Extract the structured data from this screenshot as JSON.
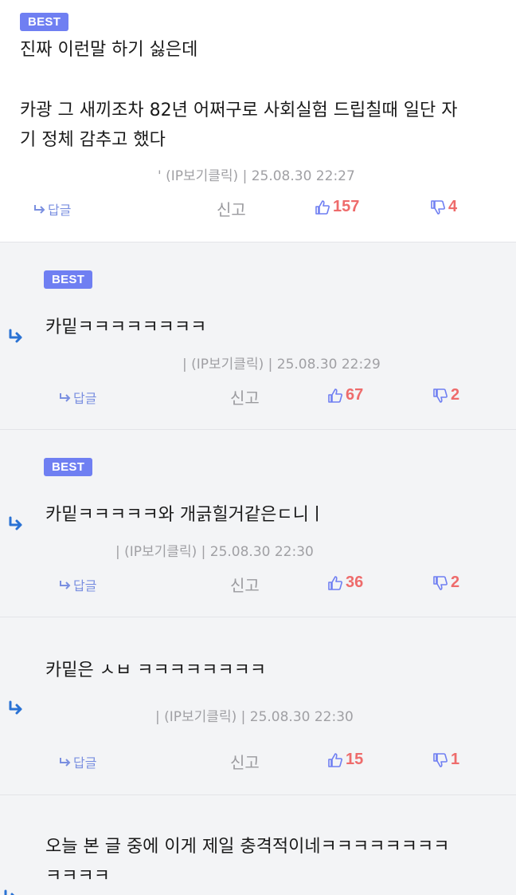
{
  "actions": {
    "reply_label": "답글",
    "report_label": "신고"
  },
  "comments": [
    {
      "badge": "BEST",
      "line1": "진짜 이런말 하기 싫은데",
      "line2": "카광 그 새끼조차 82년 어쩌구로 사회실험 드립칠때 일단 자",
      "line3": "기 정체 감추고 했다",
      "meta": "' (IP보기클릭) | 25.08.30 22:27",
      "upvotes": "157",
      "downvotes": "4"
    },
    {
      "badge": "BEST",
      "line1": "카밑ㅋㅋㅋㅋㅋㅋㅋㅋ",
      "meta": "| (IP보기클릭) | 25.08.30 22:29",
      "upvotes": "67",
      "downvotes": "2"
    },
    {
      "badge": "BEST",
      "line1": "카밑ㅋㅋㅋㅋㅋ와 개긁힐거같은ㄷ니ㅣ",
      "meta": "| (IP보기클릭) | 25.08.30 22:30",
      "upvotes": "36",
      "downvotes": "2"
    },
    {
      "line1": "카밑은 ㅅㅂ ㅋㅋㅋㅋㅋㅋㅋㅋ",
      "meta": "| (IP보기클릭) | 25.08.30 22:30",
      "upvotes": "15",
      "downvotes": "1"
    },
    {
      "line1": "오늘 본 글 중에 이게 제일 충격적이네ㅋㅋㅋㅋㅋㅋㅋㅋ",
      "line2": "ㅋㅋㅋㅋ"
    }
  ],
  "colors": {
    "badge": "#6f7ff2",
    "vote": "#ee6b6b",
    "reply": "#7a8fe0",
    "reply_arrow": "#2a72d4"
  }
}
